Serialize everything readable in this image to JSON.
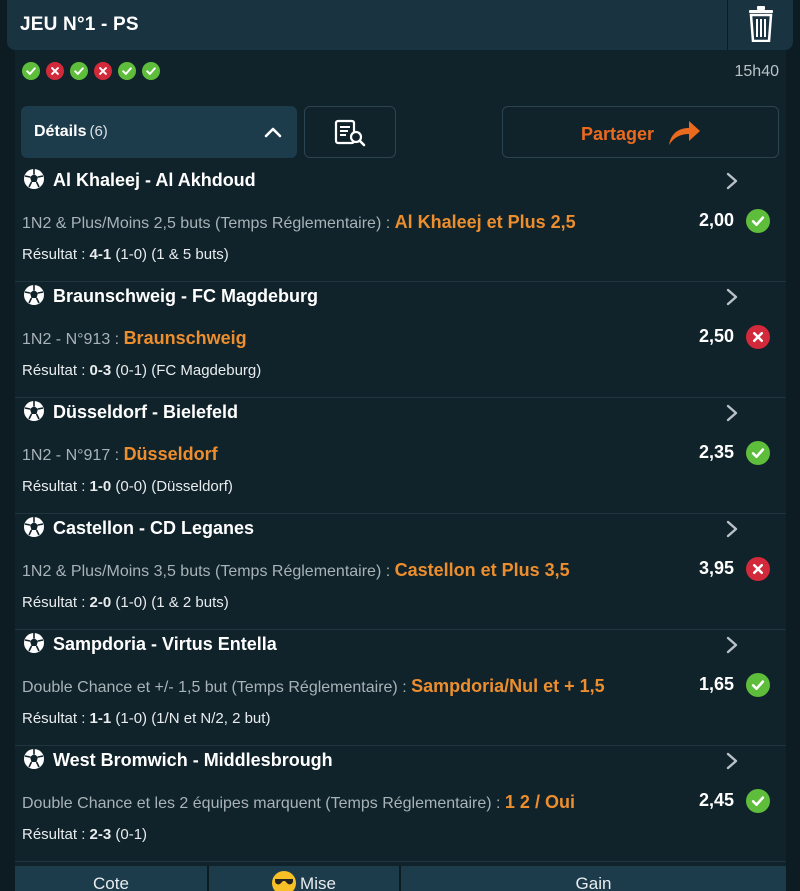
{
  "header": {
    "title": "JEU N°1  - PS"
  },
  "status": {
    "results": [
      "win",
      "loss",
      "win",
      "loss",
      "win",
      "win"
    ],
    "time": "15h40"
  },
  "actions": {
    "details_label": "Détails",
    "details_count": "(6)",
    "share_label": "Partager"
  },
  "matches": [
    {
      "title": "Al Khaleej - Al Akhdoud",
      "bet_type": "1N2 & Plus/Moins 2,5 buts (Temps Réglementaire) : ",
      "selection": "Al Khaleej et Plus 2,5",
      "odds": "2,00",
      "status": "win",
      "result_label": "Résultat : ",
      "score": "4-1",
      "result_detail": " (1-0) (1 & 5 buts)"
    },
    {
      "title": "Braunschweig - FC Magdeburg",
      "bet_type": "1N2 - N°913 : ",
      "selection": "Braunschweig",
      "odds": "2,50",
      "status": "loss",
      "result_label": "Résultat : ",
      "score": "0-3",
      "result_detail": " (0-1) (FC Magdeburg)"
    },
    {
      "title": "Düsseldorf - Bielefeld",
      "bet_type": "1N2 - N°917 : ",
      "selection": "Düsseldorf",
      "odds": "2,35",
      "status": "win",
      "result_label": "Résultat : ",
      "score": "1-0",
      "result_detail": " (0-0) (Düsseldorf)"
    },
    {
      "title": "Castellon - CD Leganes",
      "bet_type": "1N2 & Plus/Moins 3,5 buts (Temps Réglementaire) : ",
      "selection": "Castellon et Plus 3,5",
      "odds": "3,95",
      "status": "loss",
      "result_label": "Résultat : ",
      "score": "2-0",
      "result_detail": " (1-0) (1 & 2 buts)"
    },
    {
      "title": "Sampdoria - Virtus Entella",
      "bet_type": "Double Chance et +/- 1,5 but (Temps Réglementaire) : ",
      "selection": "Sampdoria/Nul et + 1,5",
      "odds": "1,65",
      "status": "win",
      "result_label": "Résultat : ",
      "score": "1-1",
      "result_detail": " (1-0) (1/N et N/2, 2 but)"
    },
    {
      "title": "West Bromwich - Middlesbrough",
      "bet_type": "Double Chance et les 2 équipes marquent (Temps Réglementaire) : ",
      "selection": "1 2 / Oui",
      "odds": "2,45",
      "status": "win",
      "result_label": "Résultat : ",
      "score": "2-3",
      "result_detail": " (0-1)"
    }
  ],
  "footer": {
    "cote_label": "Cote",
    "mise_label": "Mise",
    "gain_label": "Gain"
  },
  "colors": {
    "background": "#0c1c22",
    "header": "#1a3340",
    "accent_orange": "#ec6a1e",
    "win_green": "#5fbd3c",
    "loss_red": "#d22a3a"
  },
  "icons": {
    "delete": "trash-icon",
    "collapse": "chevron-up-icon",
    "receipt": "receipt-search-icon",
    "share": "share-arrow-icon",
    "sport": "soccer-ball-icon",
    "open": "chevron-right-icon",
    "mise": "sunglasses-emoji-icon"
  }
}
